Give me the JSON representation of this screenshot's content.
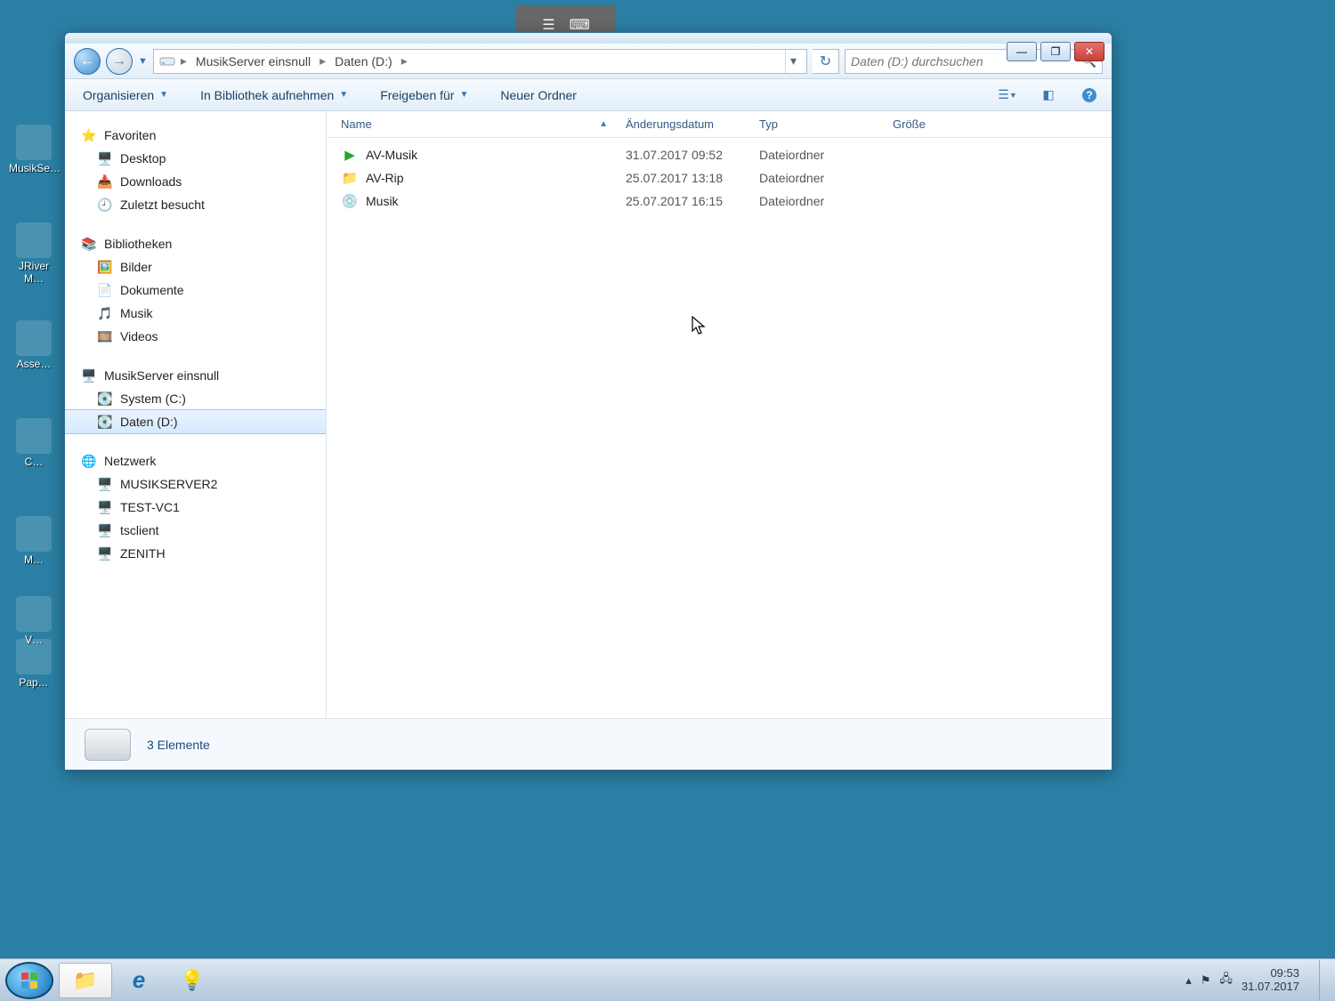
{
  "desktop": {
    "icons": [
      "MusikSe…",
      "JRiver M…",
      "Asse…",
      "C…",
      "M…",
      "V…",
      "Pap…"
    ]
  },
  "window": {
    "breadcrumb": {
      "root": "MusikServer einsnull",
      "cur": "Daten (D:)"
    },
    "search_placeholder": "Daten (D:) durchsuchen",
    "commands": {
      "organize": "Organisieren",
      "include_lib": "In Bibliothek aufnehmen",
      "share": "Freigeben für",
      "new_folder": "Neuer Ordner"
    },
    "nav": {
      "favorites": {
        "label": "Favoriten",
        "items": [
          "Desktop",
          "Downloads",
          "Zuletzt besucht"
        ]
      },
      "libraries": {
        "label": "Bibliotheken",
        "items": [
          "Bilder",
          "Dokumente",
          "Musik",
          "Videos"
        ]
      },
      "computer": {
        "label": "MusikServer einsnull",
        "items": [
          "System (C:)",
          "Daten (D:)"
        ],
        "selected": "Daten (D:)"
      },
      "network": {
        "label": "Netzwerk",
        "items": [
          "MUSIKSERVER2",
          "TEST-VC1",
          "tsclient",
          "ZENITH"
        ]
      }
    },
    "columns": {
      "name": "Name",
      "date": "Änderungsdatum",
      "type": "Typ",
      "size": "Größe"
    },
    "rows": [
      {
        "name": "AV-Musik",
        "date": "31.07.2017 09:52",
        "type": "Dateiordner",
        "icon": "play"
      },
      {
        "name": "AV-Rip",
        "date": "25.07.2017 13:18",
        "type": "Dateiordner",
        "icon": "folder"
      },
      {
        "name": "Musik",
        "date": "25.07.2017 16:15",
        "type": "Dateiordner",
        "icon": "disc"
      }
    ],
    "status": "3 Elemente"
  },
  "taskbar": {
    "time": "09:53",
    "date": "31.07.2017"
  }
}
